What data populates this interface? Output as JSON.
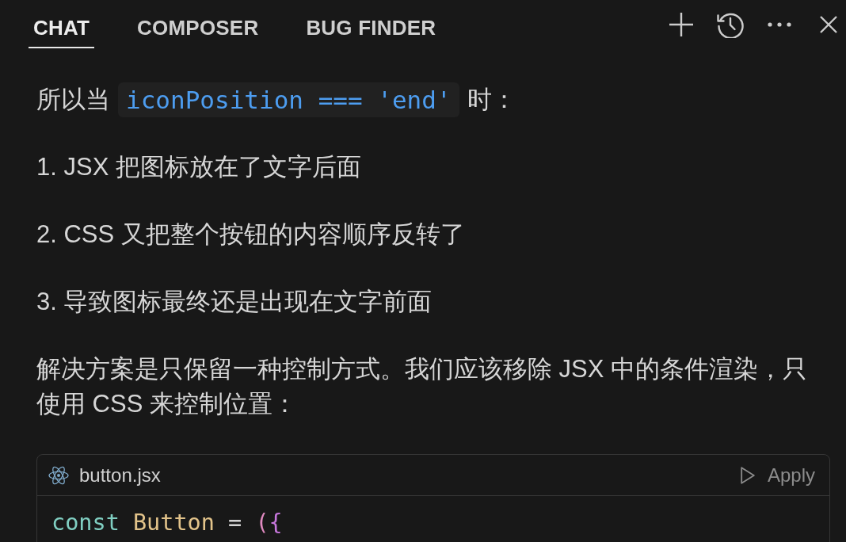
{
  "tabs": [
    {
      "label": "CHAT",
      "selected": true
    },
    {
      "label": "COMPOSER",
      "selected": false
    },
    {
      "label": "BUG FINDER",
      "selected": false
    }
  ],
  "messages": [
    {
      "kind": "mixed",
      "segments": [
        {
          "kind": "text",
          "text": "所以当"
        },
        {
          "kind": "code",
          "text": "iconPosition === 'end'"
        },
        {
          "kind": "text",
          "text": "时："
        }
      ]
    },
    {
      "kind": "text",
      "text": "1. JSX 把图标放在了文字后面"
    },
    {
      "kind": "text",
      "text": "2. CSS 又把整个按钮的内容顺序反转了"
    },
    {
      "kind": "text",
      "text": "3. 导致图标最终还是出现在文字前面"
    },
    {
      "kind": "text",
      "text": "解决方案是只保留一种控制方式。我们应该移除 JSX 中的条件渲染，只使用 CSS 来控制位置："
    },
    {
      "kind": "codeblock",
      "filename": "button.jsx",
      "action": "Apply",
      "lines": [
        [
          {
            "kind": "keyword",
            "text": "const "
          },
          {
            "kind": "name",
            "text": "Button "
          },
          {
            "kind": "operator",
            "text": "= "
          },
          {
            "kind": "paren",
            "text": "("
          },
          {
            "kind": "brace",
            "text": "{"
          }
        ]
      ]
    }
  ]
}
